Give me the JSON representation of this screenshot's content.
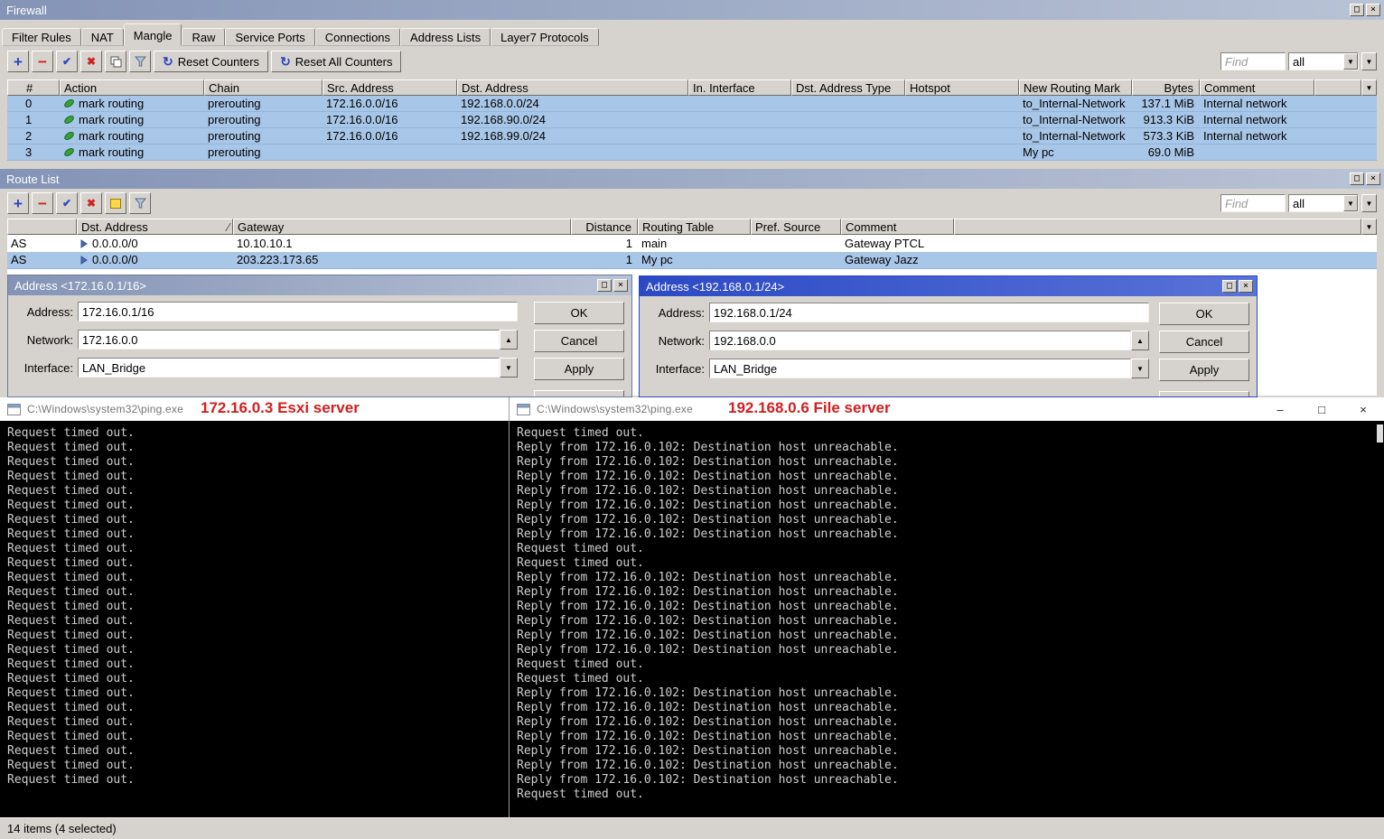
{
  "icons": {
    "plus": "+",
    "minus": "−",
    "check": "✔",
    "cross": "✖",
    "up": "▲",
    "down": "▼",
    "reset": "↻",
    "sort_asc": "∕",
    "maximize": "□",
    "close": "×",
    "minimize": "–"
  },
  "firewall": {
    "title": "Firewall",
    "tabs": [
      "Filter Rules",
      "NAT",
      "Mangle",
      "Raw",
      "Service Ports",
      "Connections",
      "Address Lists",
      "Layer7 Protocols"
    ],
    "active_tab": "Mangle",
    "toolbar": {
      "reset_counters": "Reset Counters",
      "reset_all_counters": "Reset All Counters",
      "find": "Find",
      "scope": "all"
    },
    "columns": [
      "#",
      "Action",
      "Chain",
      "Src. Address",
      "Dst. Address",
      "In. Interface",
      "Dst. Address Type",
      "Hotspot",
      "New Routing Mark",
      "Bytes",
      "Comment"
    ],
    "rows": [
      {
        "n": "0",
        "action": "mark routing",
        "chain": "prerouting",
        "src": "172.16.0.0/16",
        "dst": "192.168.0.0/24",
        "in_interface": "",
        "dst_type": "",
        "hotspot": "",
        "mark": "to_Internal-Network",
        "bytes": "137.1 MiB",
        "comment": "Internal network"
      },
      {
        "n": "1",
        "action": "mark routing",
        "chain": "prerouting",
        "src": "172.16.0.0/16",
        "dst": "192.168.90.0/24",
        "in_interface": "",
        "dst_type": "",
        "hotspot": "",
        "mark": "to_Internal-Network",
        "bytes": "913.3 KiB",
        "comment": "Internal network"
      },
      {
        "n": "2",
        "action": "mark routing",
        "chain": "prerouting",
        "src": "172.16.0.0/16",
        "dst": "192.168.99.0/24",
        "in_interface": "",
        "dst_type": "",
        "hotspot": "",
        "mark": "to_Internal-Network",
        "bytes": "573.3 KiB",
        "comment": "Internal network"
      },
      {
        "n": "3",
        "action": "mark routing",
        "chain": "prerouting",
        "src": "",
        "dst": "",
        "in_interface": "",
        "dst_type": "",
        "hotspot": "",
        "mark": "My pc",
        "bytes": "69.0 MiB",
        "comment": ""
      }
    ],
    "status": "14 items (4 selected)"
  },
  "route_list": {
    "title": "Route List",
    "toolbar": {
      "find": "Find",
      "scope": "all"
    },
    "columns": [
      "Dst. Address",
      "Gateway",
      "Distance",
      "Routing Table",
      "Pref. Source",
      "Comment"
    ],
    "rows": [
      {
        "flags": "AS",
        "dst": "0.0.0.0/0",
        "gateway": "10.10.10.1",
        "distance": "1",
        "table": "main",
        "pref_source": "",
        "comment": "Gateway PTCL"
      },
      {
        "flags": "AS",
        "dst": "0.0.0.0/0",
        "gateway": "203.223.173.65",
        "distance": "1",
        "table": "My pc",
        "pref_source": "",
        "comment": "Gateway Jazz"
      }
    ]
  },
  "address_dialog_left": {
    "title": "Address <172.16.0.1/16>",
    "address_label": "Address:",
    "address": "172.16.0.1/16",
    "network_label": "Network:",
    "network": "172.16.0.0",
    "interface_label": "Interface:",
    "interface": "LAN_Bridge",
    "ok": "OK",
    "cancel": "Cancel",
    "apply": "Apply"
  },
  "address_dialog_right": {
    "title": "Address <192.168.0.1/24>",
    "address_label": "Address:",
    "address": "192.168.0.1/24",
    "network_label": "Network:",
    "network": "192.168.0.0",
    "interface_label": "Interface:",
    "interface": "LAN_Bridge",
    "ok": "OK",
    "cancel": "Cancel",
    "apply": "Apply"
  },
  "terminal_left": {
    "title_path": "C:\\Windows\\system32\\ping.exe",
    "annotation": "172.16.0.3 Esxi server",
    "lines": [
      "Request timed out.",
      "Request timed out.",
      "Request timed out.",
      "Request timed out.",
      "Request timed out.",
      "Request timed out.",
      "Request timed out.",
      "Request timed out.",
      "Request timed out.",
      "Request timed out.",
      "Request timed out.",
      "Request timed out.",
      "Request timed out.",
      "Request timed out.",
      "Request timed out.",
      "Request timed out.",
      "Request timed out.",
      "Request timed out.",
      "Request timed out.",
      "Request timed out.",
      "Request timed out.",
      "Request timed out.",
      "Request timed out.",
      "Request timed out.",
      "Request timed out."
    ]
  },
  "terminal_right": {
    "title_path": "C:\\Windows\\system32\\ping.exe",
    "annotation": "192.168.0.6 File server",
    "lines": [
      "Request timed out.",
      "Reply from 172.16.0.102: Destination host unreachable.",
      "Reply from 172.16.0.102: Destination host unreachable.",
      "Reply from 172.16.0.102: Destination host unreachable.",
      "Reply from 172.16.0.102: Destination host unreachable.",
      "Reply from 172.16.0.102: Destination host unreachable.",
      "Reply from 172.16.0.102: Destination host unreachable.",
      "Reply from 172.16.0.102: Destination host unreachable.",
      "Request timed out.",
      "Request timed out.",
      "Reply from 172.16.0.102: Destination host unreachable.",
      "Reply from 172.16.0.102: Destination host unreachable.",
      "Reply from 172.16.0.102: Destination host unreachable.",
      "Reply from 172.16.0.102: Destination host unreachable.",
      "Reply from 172.16.0.102: Destination host unreachable.",
      "Reply from 172.16.0.102: Destination host unreachable.",
      "Request timed out.",
      "Request timed out.",
      "Reply from 172.16.0.102: Destination host unreachable.",
      "Reply from 172.16.0.102: Destination host unreachable.",
      "Reply from 172.16.0.102: Destination host unreachable.",
      "Reply from 172.16.0.102: Destination host unreachable.",
      "Reply from 172.16.0.102: Destination host unreachable.",
      "Reply from 172.16.0.102: Destination host unreachable.",
      "Reply from 172.16.0.102: Destination host unreachable.",
      "Request timed out."
    ]
  }
}
